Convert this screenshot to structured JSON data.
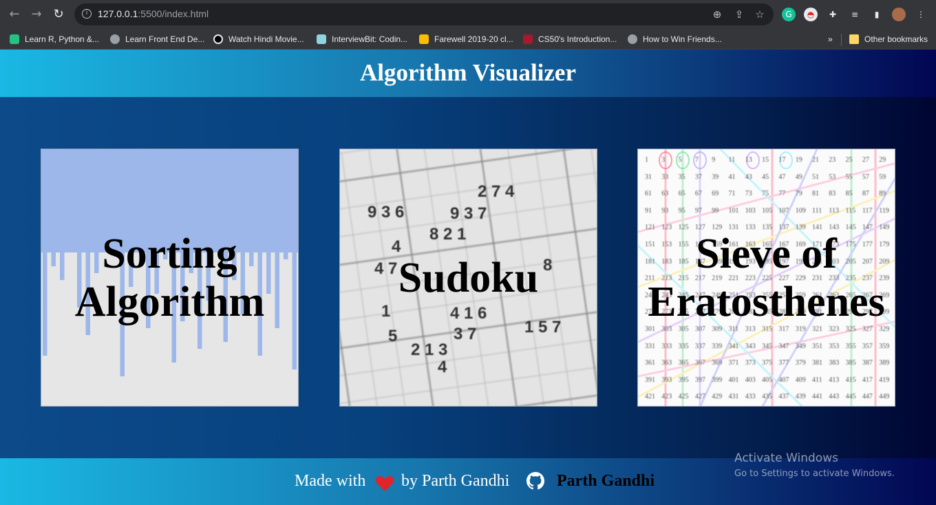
{
  "browser": {
    "url_host": "127.0.0.1",
    "url_path": ":5500/index.html",
    "bookmarks": [
      {
        "label": "Learn R, Python &...",
        "color": "#26c281"
      },
      {
        "label": "Learn Front End De...",
        "color": "#9aa0a6"
      },
      {
        "label": "Watch Hindi Movie...",
        "color": "#000000"
      },
      {
        "label": "InterviewBit: Codin...",
        "color": "#8fd3e0"
      },
      {
        "label": "Farewell 2019-20 cl...",
        "color": "#fbbc04"
      },
      {
        "label": "CS50's Introduction...",
        "color": "#a6192e"
      },
      {
        "label": "How to Win Friends...",
        "color": "#9aa0a6"
      }
    ],
    "bookmarks_overflow": "»",
    "other_bookmarks": "Other bookmarks"
  },
  "header": {
    "title": "Algorithm Visualizer"
  },
  "cards": {
    "sorting": {
      "label": "Sorting Algorithm"
    },
    "sudoku": {
      "label": "Sudoku"
    },
    "sieve": {
      "label": "Sieve of Eratosthenes"
    }
  },
  "footer": {
    "made_with": "Made with",
    "by": "by Parth Gandhi",
    "link": "Parth Gandhi"
  },
  "watermark": {
    "title": "Activate Windows",
    "subtitle": "Go to Settings to activate Windows."
  },
  "icons": {
    "back": "back-arrow-icon",
    "forward": "forward-arrow-icon",
    "reload": "reload-icon",
    "heart": "heart-icon",
    "github": "github-icon"
  },
  "colors": {
    "header_gradient_start": "#1ab8e4",
    "header_gradient_end": "#010653",
    "heart": "#e0242a"
  }
}
